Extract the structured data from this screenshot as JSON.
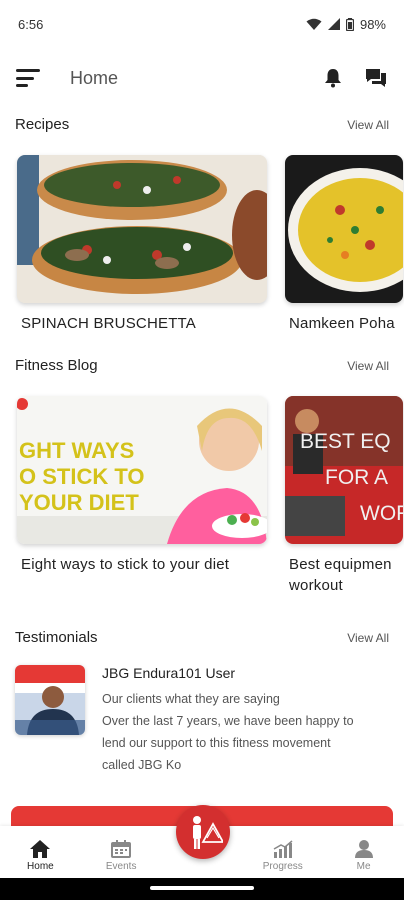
{
  "status_bar": {
    "time": "6:56",
    "battery": "98%"
  },
  "app_bar": {
    "title": "Home",
    "icons": [
      "menu-icon",
      "bell-icon",
      "chat-icon"
    ]
  },
  "recipes": {
    "title": "Recipes",
    "view_all": "View All",
    "items": [
      {
        "label": "SPINACH BRUSCHETTA"
      },
      {
        "label": "Namkeen Poha"
      }
    ]
  },
  "fitness_blog": {
    "title": "Fitness Blog",
    "view_all": "View All",
    "items": [
      {
        "label": "Eight ways to stick to your diet",
        "image_text": [
          "GHT WAYS",
          "O STICK TO",
          "YOUR DIET"
        ]
      },
      {
        "label": "Best equipmen workout",
        "line1": "Best equipmen",
        "line2": "workout",
        "image_text": [
          "BEST EQ",
          "FOR A",
          "WOR"
        ]
      }
    ]
  },
  "testimonials": {
    "title": "Testimonials",
    "view_all": "View All",
    "item": {
      "name": "JBG Endura101 User",
      "line1": "Our clients what they are saying",
      "line2": "Over the last 7 years, we have been happy to",
      "line3": "lend our support to this fitness movement",
      "line4": "called JBG Ko"
    }
  },
  "bottom_nav": {
    "items": [
      {
        "label": "Home",
        "icon": "home-icon",
        "active": true
      },
      {
        "label": "Events",
        "icon": "events-icon",
        "active": false
      },
      {
        "label": "Progress",
        "icon": "progress-icon",
        "active": false
      },
      {
        "label": "Me",
        "icon": "person-icon",
        "active": false
      }
    ],
    "center_icon": "jbg-logo-icon"
  },
  "colors": {
    "accent": "#d32f2f",
    "banner": "#e53935"
  }
}
